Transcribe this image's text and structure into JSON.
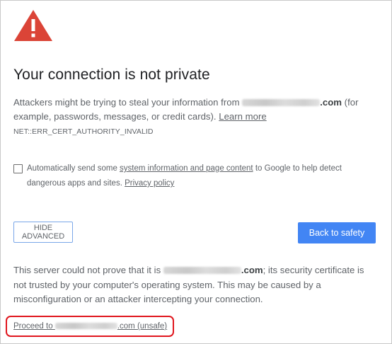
{
  "page": {
    "title": "Your connection is not private",
    "description_prefix": "Attackers might be trying to steal your information from ",
    "domain_suffix": ".com",
    "description_suffix": " (for example, passwords, messages, or credit cards). ",
    "learn_more": "Learn more",
    "error_code": "NET::ERR_CERT_AUTHORITY_INVALID"
  },
  "reporting": {
    "prefix": "Automatically send some ",
    "link": "system information and page content",
    "suffix": " to Google to help detect dangerous apps and sites. ",
    "privacy_link": "Privacy policy",
    "checked": false
  },
  "buttons": {
    "hide_advanced": "HIDE ADVANCED",
    "back_to_safety": "Back to safety"
  },
  "details": {
    "prefix": "This server could not prove that it is ",
    "domain_suffix": ".com",
    "suffix": "; its security certificate is not trusted by your computer's operating system. This may be caused by a misconfiguration or an attacker intercepting your connection."
  },
  "proceed": {
    "prefix": "Proceed to ",
    "suffix": ".com (unsafe)"
  },
  "colors": {
    "warning_icon": "#db4437",
    "primary_button": "#4285f4",
    "highlight_border": "#e0161e"
  },
  "icons": [
    "warning-triangle-icon"
  ]
}
